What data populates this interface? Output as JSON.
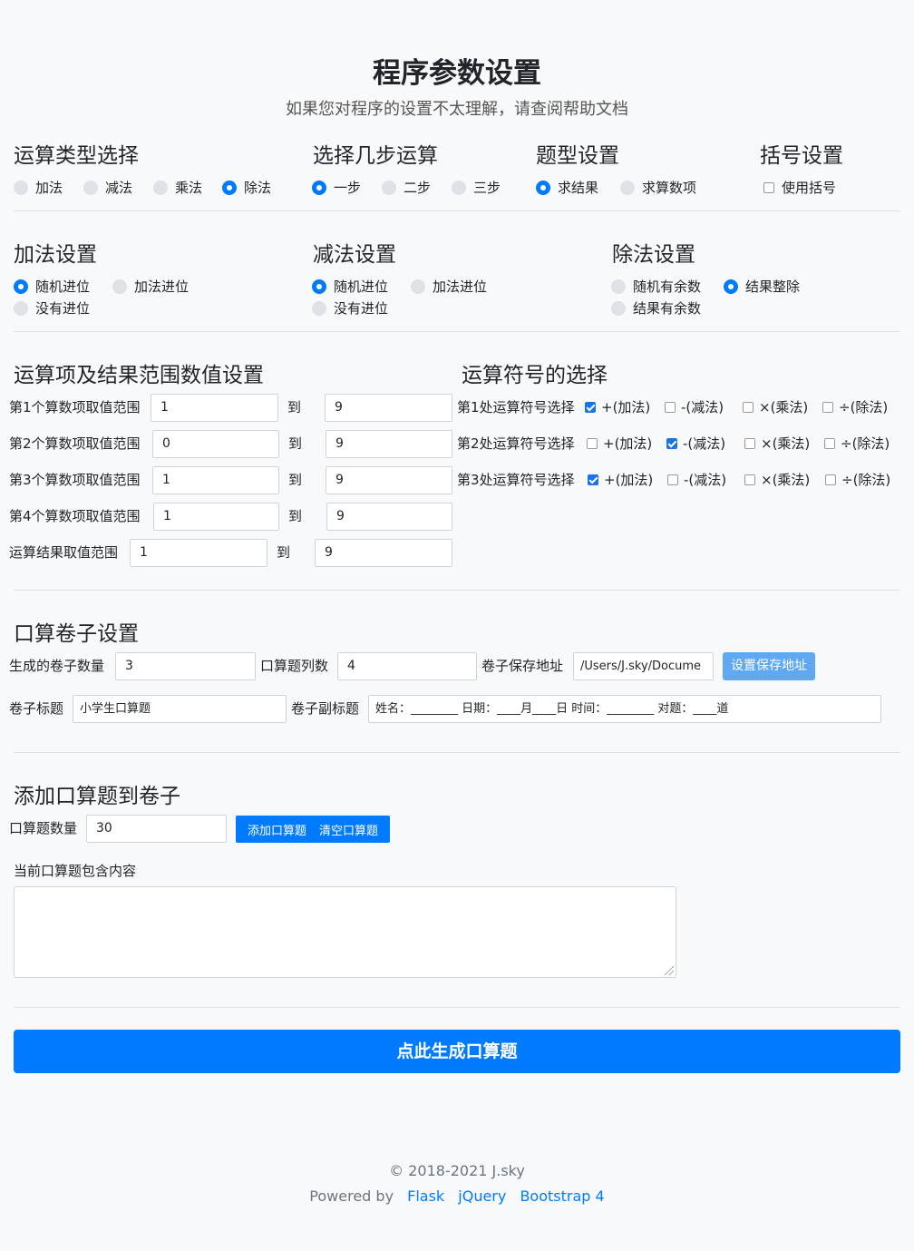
{
  "header": {
    "title": "程序参数设置",
    "subtitle": "如果您对程序的设置不太理解，请查阅帮助文档"
  },
  "op_type": {
    "title": "运算类型选择",
    "options": [
      {
        "label": "加法",
        "checked": false
      },
      {
        "label": "减法",
        "checked": false
      },
      {
        "label": "乘法",
        "checked": false
      },
      {
        "label": "除法",
        "checked": true
      }
    ]
  },
  "steps": {
    "title": "选择几步运算",
    "options": [
      {
        "label": "一步",
        "checked": true
      },
      {
        "label": "二步",
        "checked": false
      },
      {
        "label": "三步",
        "checked": false
      }
    ]
  },
  "question_type": {
    "title": "题型设置",
    "options": [
      {
        "label": "求结果",
        "checked": true
      },
      {
        "label": "求算数项",
        "checked": false
      }
    ]
  },
  "brackets": {
    "title": "括号设置",
    "option": {
      "label": "使用括号",
      "checked": false
    }
  },
  "add_settings": {
    "title": "加法设置",
    "options": [
      {
        "label": "随机进位",
        "checked": true
      },
      {
        "label": "加法进位",
        "checked": false
      },
      {
        "label": "没有进位",
        "checked": false
      }
    ]
  },
  "sub_settings": {
    "title": "减法设置",
    "options": [
      {
        "label": "随机进位",
        "checked": true
      },
      {
        "label": "加法进位",
        "checked": false
      },
      {
        "label": "没有进位",
        "checked": false
      }
    ]
  },
  "div_settings": {
    "title": "除法设置",
    "options": [
      {
        "label": "随机有余数",
        "checked": false
      },
      {
        "label": "结果整除",
        "checked": true
      },
      {
        "label": "结果有余数",
        "checked": false
      }
    ]
  },
  "ranges": {
    "title": "运算项及结果范围数值设置",
    "to_label": "到",
    "rows": [
      {
        "label": "第1个算数项取值范围",
        "min": "1",
        "max": "9"
      },
      {
        "label": "第2个算数项取值范围",
        "min": "0",
        "max": "9"
      },
      {
        "label": "第3个算数项取值范围",
        "min": "1",
        "max": "9"
      },
      {
        "label": "第4个算数项取值范围",
        "min": "1",
        "max": "9"
      },
      {
        "label": "运算结果取值范围",
        "min": "1",
        "max": "9"
      }
    ]
  },
  "symbols": {
    "title": "运算符号的选择",
    "rows": [
      {
        "label": "第1处运算符号选择",
        "options": [
          {
            "label": "+(加法)",
            "checked": true
          },
          {
            "label": "-(减法)",
            "checked": false
          },
          {
            "label": "×(乘法)",
            "checked": false
          },
          {
            "label": "÷(除法)",
            "checked": false
          }
        ]
      },
      {
        "label": "第2处运算符号选择",
        "options": [
          {
            "label": "+(加法)",
            "checked": false
          },
          {
            "label": "-(减法)",
            "checked": true
          },
          {
            "label": "×(乘法)",
            "checked": false
          },
          {
            "label": "÷(除法)",
            "checked": false
          }
        ]
      },
      {
        "label": "第3处运算符号选择",
        "options": [
          {
            "label": "+(加法)",
            "checked": true
          },
          {
            "label": "-(减法)",
            "checked": false
          },
          {
            "label": "×(乘法)",
            "checked": false
          },
          {
            "label": "÷(除法)",
            "checked": false
          }
        ]
      }
    ]
  },
  "paper": {
    "title": "口算卷子设置",
    "count_label": "生成的卷子数量",
    "count_value": "3",
    "columns_label": "口算题列数",
    "columns_value": "4",
    "path_label": "卷子保存地址",
    "path_value": "/Users/J.sky/Docume",
    "path_button": "设置保存地址",
    "title_label": "卷子标题",
    "title_value": "小学生口算题",
    "subtitle_label": "卷子副标题",
    "subtitle_value": "姓名：________ 日期：____月____日 时间：________ 对题：____道"
  },
  "add_questions": {
    "title": "添加口算题到卷子",
    "count_label": "口算题数量",
    "count_value": "30",
    "add_button": "添加口算题",
    "clear_button": "清空口算题",
    "content_label": "当前口算题包含内容",
    "content_value": ""
  },
  "generate_button": "点此生成口算题",
  "footer": {
    "copyright": "© 2018-2021 J.sky",
    "powered_by": "Powered by",
    "links": [
      "Flask",
      "jQuery",
      "Bootstrap 4"
    ]
  }
}
